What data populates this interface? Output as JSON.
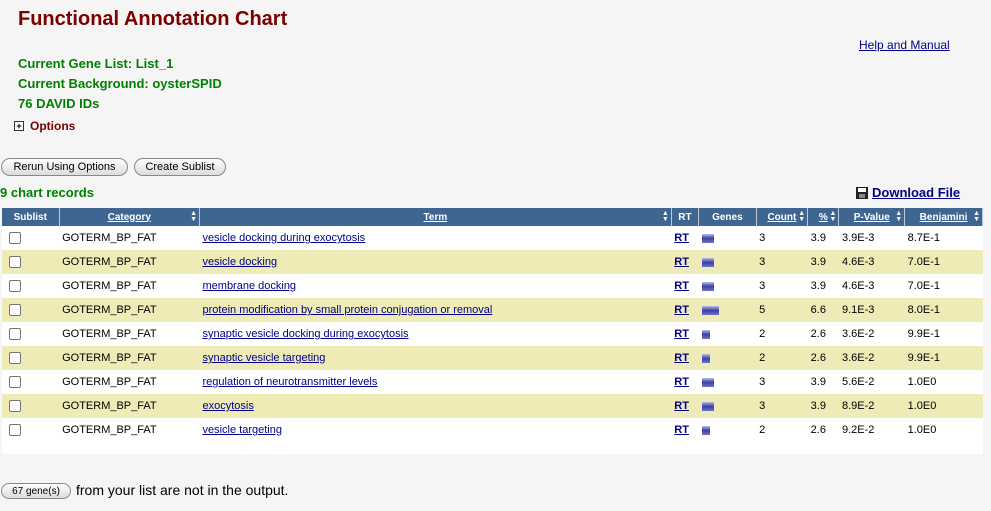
{
  "page": {
    "title": "Functional Annotation Chart",
    "help_link": "Help and Manual",
    "gene_list": "Current Gene List: List_1",
    "background": "Current Background: oysterSPID",
    "david_ids": "76 DAVID IDs",
    "options": "Options",
    "options_toggle": "+"
  },
  "buttons": {
    "rerun": "Rerun Using Options",
    "sublist": "Create Sublist"
  },
  "records": "9 chart records",
  "download": "Download File",
  "columns": [
    "Sublist",
    "Category",
    "Term",
    "RT",
    "Genes",
    "Count",
    "%",
    "P-Value",
    "Benjamini"
  ],
  "rows": [
    {
      "category": "GOTERM_BP_FAT",
      "term": "vesicle docking during exocytosis",
      "rt": "RT",
      "count": "3",
      "pct": "3.9",
      "pvalue": "3.9E-3",
      "benjamini": "8.7E-1"
    },
    {
      "category": "GOTERM_BP_FAT",
      "term": "vesicle docking",
      "rt": "RT",
      "count": "3",
      "pct": "3.9",
      "pvalue": "4.6E-3",
      "benjamini": "7.0E-1"
    },
    {
      "category": "GOTERM_BP_FAT",
      "term": "membrane docking",
      "rt": "RT",
      "count": "3",
      "pct": "3.9",
      "pvalue": "4.6E-3",
      "benjamini": "7.0E-1"
    },
    {
      "category": "GOTERM_BP_FAT",
      "term": "protein modification by small protein conjugation or removal",
      "rt": "RT",
      "count": "5",
      "pct": "6.6",
      "pvalue": "9.1E-3",
      "benjamini": "8.0E-1"
    },
    {
      "category": "GOTERM_BP_FAT",
      "term": "synaptic vesicle docking during exocytosis",
      "rt": "RT",
      "count": "2",
      "pct": "2.6",
      "pvalue": "3.6E-2",
      "benjamini": "9.9E-1"
    },
    {
      "category": "GOTERM_BP_FAT",
      "term": "synaptic vesicle targeting",
      "rt": "RT",
      "count": "2",
      "pct": "2.6",
      "pvalue": "3.6E-2",
      "benjamini": "9.9E-1"
    },
    {
      "category": "GOTERM_BP_FAT",
      "term": "regulation of neurotransmitter levels",
      "rt": "RT",
      "count": "3",
      "pct": "3.9",
      "pvalue": "5.6E-2",
      "benjamini": "1.0E0"
    },
    {
      "category": "GOTERM_BP_FAT",
      "term": "exocytosis",
      "rt": "RT",
      "count": "3",
      "pct": "3.9",
      "pvalue": "8.9E-2",
      "benjamini": "1.0E0"
    },
    {
      "category": "GOTERM_BP_FAT",
      "term": "vesicle targeting",
      "rt": "RT",
      "count": "2",
      "pct": "2.6",
      "pvalue": "9.2E-2",
      "benjamini": "1.0E0"
    }
  ],
  "footer": {
    "genes_button": "67 gene(s)",
    "genes_text": "from your list are not in the output."
  },
  "colors": {
    "title": "#7a0000",
    "green": "#008000",
    "header": "#3f6591",
    "alt_row": "#efebb6",
    "link": "#00008b"
  }
}
